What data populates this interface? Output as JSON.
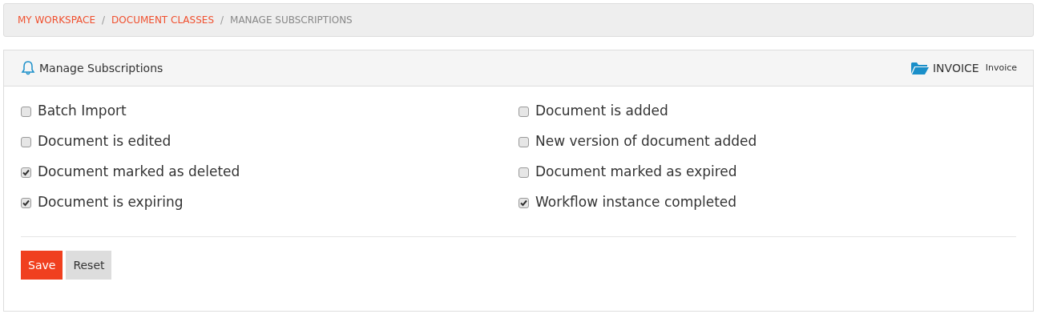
{
  "breadcrumb": [
    {
      "label": "MY WORKSPACE",
      "kind": "link"
    },
    {
      "label": "DOCUMENT CLASSES",
      "kind": "link"
    },
    {
      "label": "MANAGE SUBSCRIPTIONS",
      "kind": "current"
    }
  ],
  "breadcrumb_separator": "/",
  "panel": {
    "title": "Manage Subscriptions",
    "class_name": "INVOICE",
    "class_label": "Invoice"
  },
  "options": [
    {
      "label": "Batch Import",
      "checked": false
    },
    {
      "label": "Document is added",
      "checked": false
    },
    {
      "label": "Document is edited",
      "checked": false
    },
    {
      "label": "New version of document added",
      "checked": false
    },
    {
      "label": "Document marked as deleted",
      "checked": true
    },
    {
      "label": "Document marked as expired",
      "checked": false
    },
    {
      "label": "Document is expiring",
      "checked": true
    },
    {
      "label": "Workflow instance completed",
      "checked": true
    }
  ],
  "buttons": [
    {
      "label": "Save",
      "kind": "primary"
    },
    {
      "label": "Reset",
      "kind": "secondary"
    }
  ]
}
